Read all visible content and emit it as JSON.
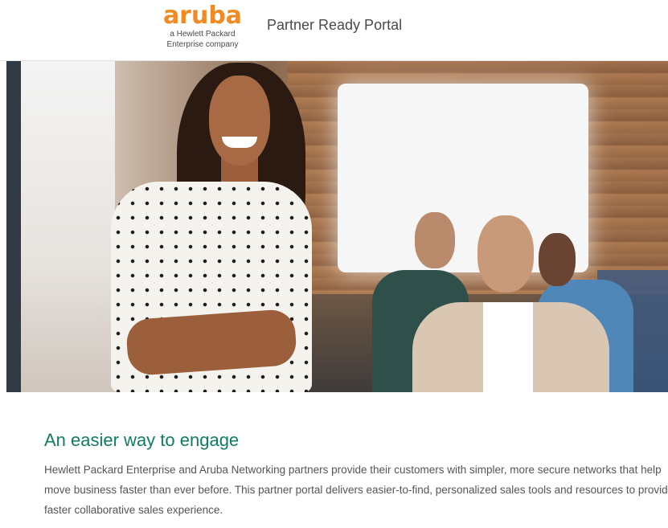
{
  "header": {
    "logo_word": "aruba",
    "logo_sub_line1": "a Hewlett Packard",
    "logo_sub_line2": "Enterprise company",
    "portal_title": "Partner Ready Portal"
  },
  "colors": {
    "brand_orange": "#f08a24",
    "heading_green": "#0f7d5f"
  },
  "intro": {
    "heading": "An easier way to engage",
    "body": "Hewlett Packard Enterprise and Aruba Networking partners provide their customers with simpler, more secure networks that help move business faster than ever before. This partner portal delivers easier-to-find, personalized sales tools and resources to provide faster collaborative sales experience."
  }
}
